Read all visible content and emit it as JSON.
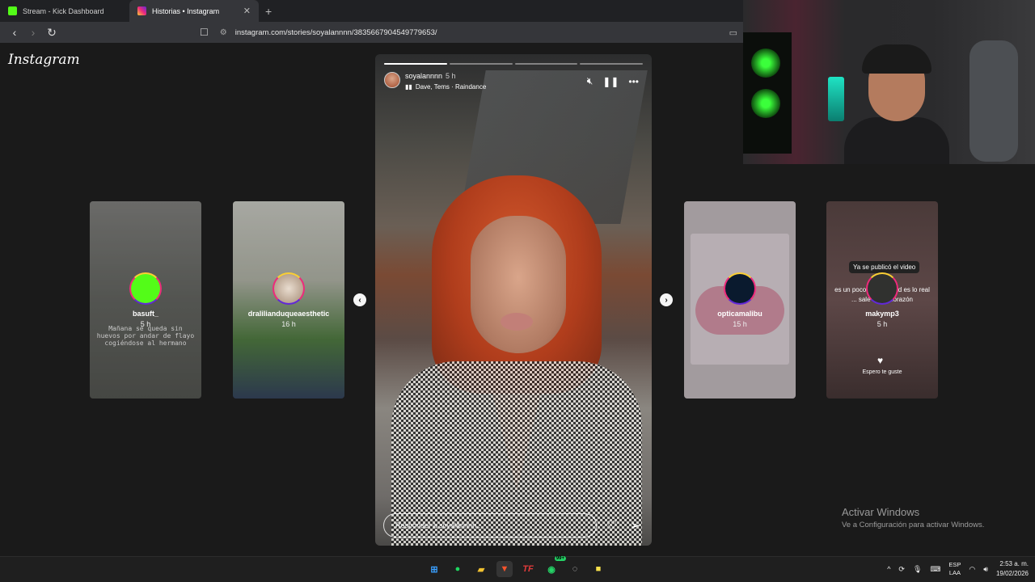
{
  "browser": {
    "tabs": [
      {
        "title": "Stream - Kick Dashboard",
        "active": false
      },
      {
        "title": "Historias • Instagram",
        "active": true
      }
    ],
    "url": "instagram.com/stories/soyalannnn/3835667904549779653/"
  },
  "instagram": {
    "logo": "Instagram",
    "main_story": {
      "username": "soyalannnn",
      "time": "5 h",
      "music": "Dave, Tems · Raindance",
      "reply_placeholder": "Responder a soyalannnn...",
      "progress": [
        1.0,
        0.0,
        0.0,
        0.0
      ]
    },
    "side_stories": [
      {
        "username": "basuft_",
        "time": "5 h",
        "caption": "Mañana se queda sin huevos por andar de flayo cogiéndose al hermano"
      },
      {
        "username": "dralilianduqueaesthetic",
        "time": "16 h"
      },
      {
        "username": "opticamalibu",
        "time": "15 h"
      },
      {
        "username": "makymp3",
        "time": "5 h",
        "bubble": "Ya se publicó el video",
        "subtitle": "es un poco ... la verdad es lo real ... sale de mi corazón",
        "footer": "Espero te guste"
      }
    ]
  },
  "watermark": {
    "title": "Activar Windows",
    "subtitle": "Ve a Configuración para activar Windows."
  },
  "taskbar": {
    "badge": "99+",
    "lang_top": "ESP",
    "lang_bottom": "LAA",
    "time": "2:53 a. m.",
    "date": "19/02/2026"
  },
  "colors": {
    "kick_green": "#53fc18",
    "background": "#1a1a1a",
    "chrome_dark": "#202124"
  }
}
